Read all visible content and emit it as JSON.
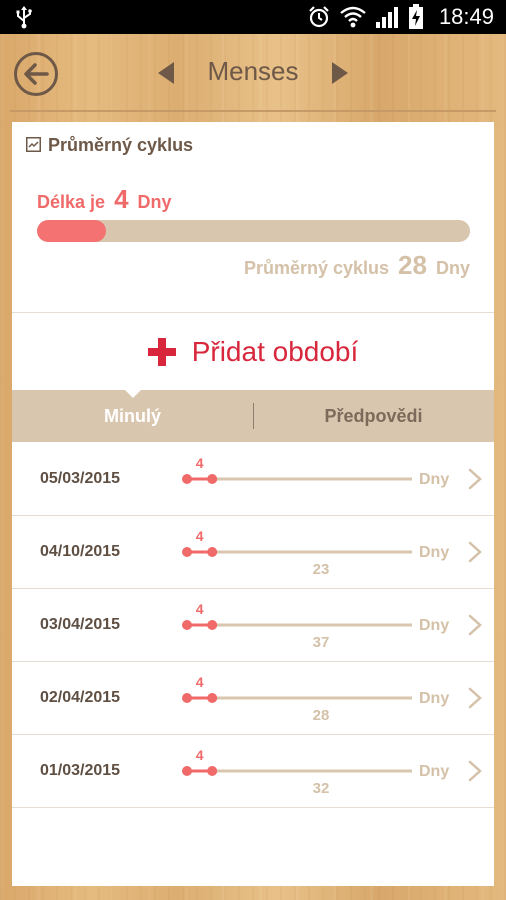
{
  "status_bar": {
    "time": "18:49"
  },
  "header": {
    "title": "Menses"
  },
  "average": {
    "title": "Průměrný cyklus",
    "length_prefix": "Délka je",
    "length_value": "4",
    "length_unit": "Dny",
    "cycle_prefix": "Průměrný cyklus",
    "cycle_value": "28",
    "cycle_unit": "Dny",
    "progress_fraction": 0.16
  },
  "add_button": {
    "label": "Přidat období"
  },
  "tabs": [
    {
      "label": "Minulý"
    },
    {
      "label": "Předpovědi"
    }
  ],
  "unit_label": "Dny",
  "periods": [
    {
      "date": "05/03/2015",
      "period_days": "4",
      "cycle_days": ""
    },
    {
      "date": "04/10/2015",
      "period_days": "4",
      "cycle_days": "23"
    },
    {
      "date": "03/04/2015",
      "period_days": "4",
      "cycle_days": "37"
    },
    {
      "date": "02/04/2015",
      "period_days": "4",
      "cycle_days": "28"
    },
    {
      "date": "01/03/2015",
      "period_days": "4",
      "cycle_days": "32"
    }
  ],
  "colors": {
    "accent": "#f06a6a",
    "add_red": "#d8273c",
    "beige": "#d8c6ae",
    "brown": "#6e5847"
  }
}
